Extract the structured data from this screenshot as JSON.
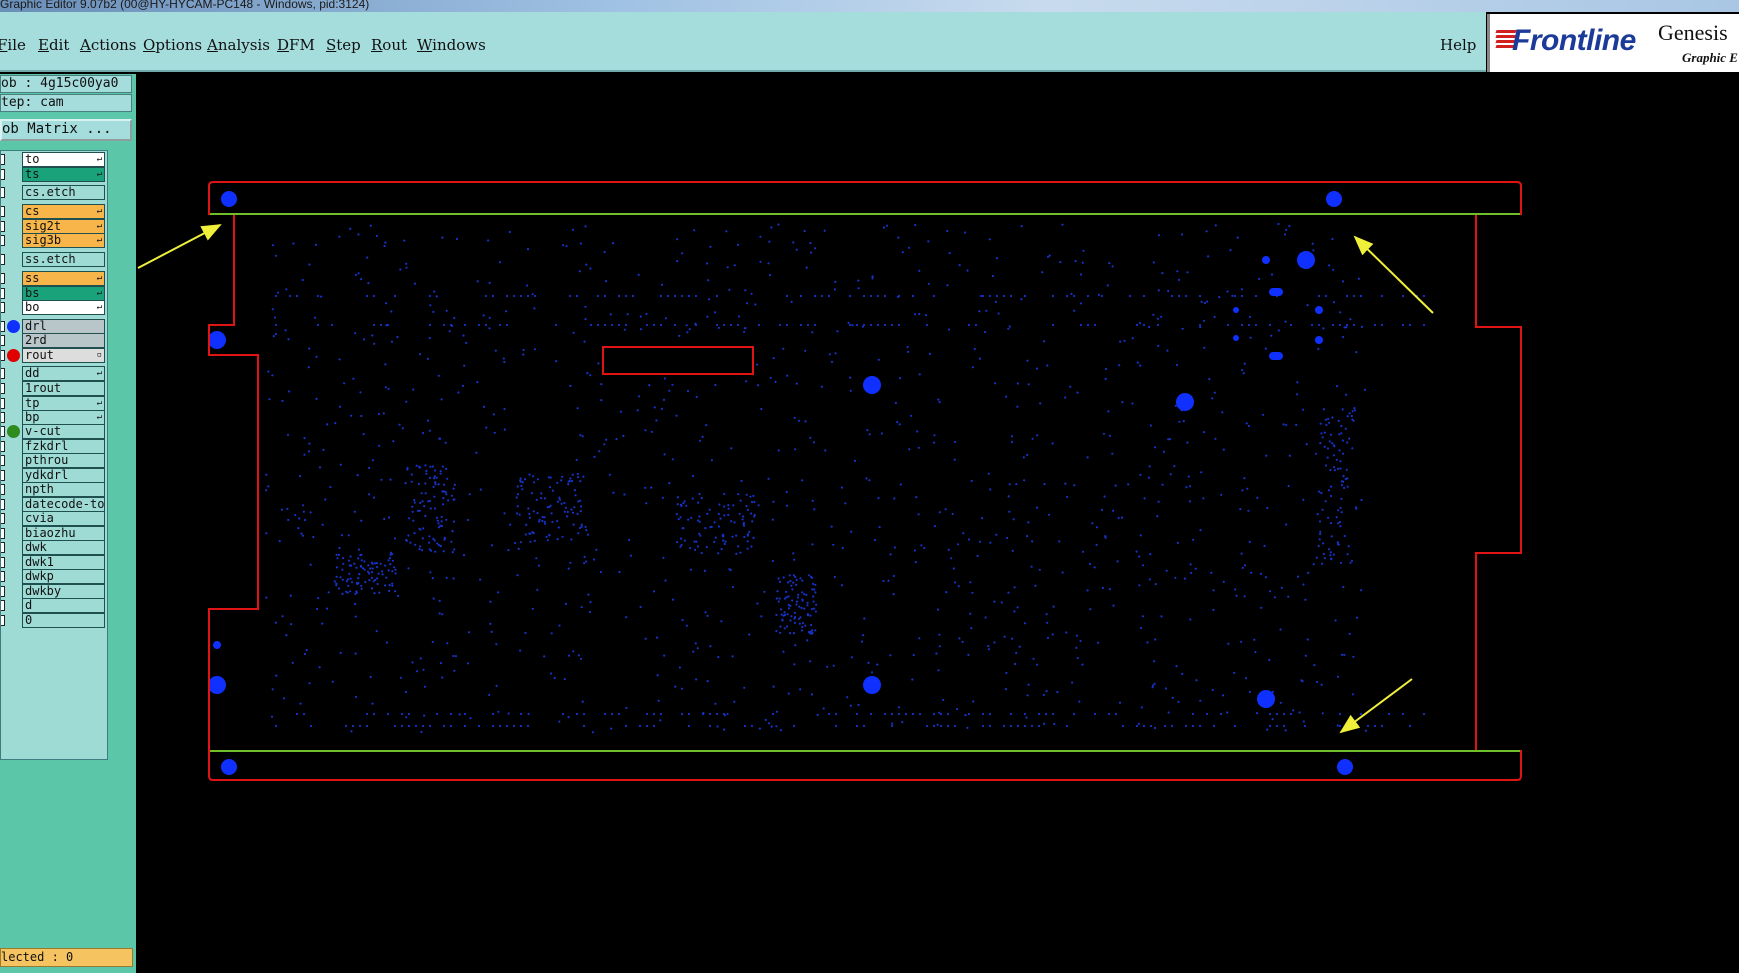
{
  "window": {
    "title": "Graphic Editor 9.07b2 (00@HY-HYCAM-PC148 - Windows, pid:3124)"
  },
  "menu": {
    "items": [
      {
        "first": "F",
        "rest": "ile"
      },
      {
        "first": "E",
        "rest": "dit"
      },
      {
        "first": "A",
        "rest": "ctions"
      },
      {
        "first": "O",
        "rest": "ptions"
      },
      {
        "first": "A",
        "rest": "nalysis"
      },
      {
        "first": "D",
        "rest": "FM"
      },
      {
        "first": "S",
        "rest": "tep"
      },
      {
        "first": "R",
        "rest": "out"
      },
      {
        "first": "W",
        "rest": "indows"
      }
    ],
    "help": "Help"
  },
  "logo": {
    "brand": "Frontline",
    "product": "Genesis",
    "subtitle": "Graphic E"
  },
  "panel": {
    "job": "ob : 4g15c00ya0",
    "step": "tep: cam",
    "job_matrix": "ob Matrix ...",
    "selected": "lected : 0"
  },
  "layers": [
    {
      "name": "to",
      "color": "#ffffff",
      "mark": "↵",
      "dot": ""
    },
    {
      "name": "ts",
      "color": "#1aa27a",
      "mark": "↵",
      "dot": ""
    },
    {
      "name": "cs.etch",
      "color": "#9edbd5",
      "mark": "",
      "dot": ""
    },
    {
      "name": "cs",
      "color": "#f7b54a",
      "mark": "↵",
      "dot": ""
    },
    {
      "name": "sig2t",
      "color": "#f7b54a",
      "mark": "↵",
      "dot": ""
    },
    {
      "name": "sig3b",
      "color": "#f7b54a",
      "mark": "↵",
      "dot": ""
    },
    {
      "name": "ss.etch",
      "color": "#9edbd5",
      "mark": "",
      "dot": ""
    },
    {
      "name": "ss",
      "color": "#f7b54a",
      "mark": "↵",
      "dot": ""
    },
    {
      "name": "bs",
      "color": "#1aa27a",
      "mark": "↵",
      "dot": ""
    },
    {
      "name": "bo",
      "color": "#ffffff",
      "mark": "↵",
      "dot": ""
    },
    {
      "name": "drl",
      "color": "#b9c6c9",
      "mark": "",
      "dot": "#1030ff"
    },
    {
      "name": "2rd",
      "color": "#b9c6c9",
      "mark": "",
      "dot": ""
    },
    {
      "name": "rout",
      "color": "#dddddd",
      "mark": "▫",
      "dot": "#e00000"
    },
    {
      "name": "dd",
      "color": "#9edbd5",
      "mark": "↵",
      "dot": ""
    },
    {
      "name": "1rout",
      "color": "#9edbd5",
      "mark": "",
      "dot": ""
    },
    {
      "name": "tp",
      "color": "#9edbd5",
      "mark": "↵",
      "dot": ""
    },
    {
      "name": "bp",
      "color": "#9edbd5",
      "mark": "↵",
      "dot": ""
    },
    {
      "name": "v-cut",
      "color": "#9edbd5",
      "mark": "",
      "dot": "#2e8b1e"
    },
    {
      "name": "fzkdrl",
      "color": "#9edbd5",
      "mark": "",
      "dot": ""
    },
    {
      "name": "pthrou",
      "color": "#9edbd5",
      "mark": "",
      "dot": ""
    },
    {
      "name": "ydkdrl",
      "color": "#9edbd5",
      "mark": "",
      "dot": ""
    },
    {
      "name": "npth",
      "color": "#9edbd5",
      "mark": "",
      "dot": ""
    },
    {
      "name": "datecode-to",
      "color": "#9edbd5",
      "mark": "",
      "dot": ""
    },
    {
      "name": "cvia",
      "color": "#9edbd5",
      "mark": "",
      "dot": ""
    },
    {
      "name": "biaozhu",
      "color": "#9edbd5",
      "mark": "",
      "dot": ""
    },
    {
      "name": "dwk",
      "color": "#9edbd5",
      "mark": "",
      "dot": ""
    },
    {
      "name": "dwk1",
      "color": "#9edbd5",
      "mark": "",
      "dot": ""
    },
    {
      "name": "dwkp",
      "color": "#9edbd5",
      "mark": "",
      "dot": ""
    },
    {
      "name": "dwkby",
      "color": "#9edbd5",
      "mark": "",
      "dot": ""
    },
    {
      "name": "d",
      "color": "#9edbd5",
      "mark": "",
      "dot": ""
    },
    {
      "name": "0",
      "color": "#9edbd5",
      "mark": "",
      "dot": ""
    }
  ],
  "colors": {
    "outline": "#e01414",
    "vcut": "#6fbf2a",
    "drill": "#1030ff",
    "arrow": "#f0f03a"
  }
}
